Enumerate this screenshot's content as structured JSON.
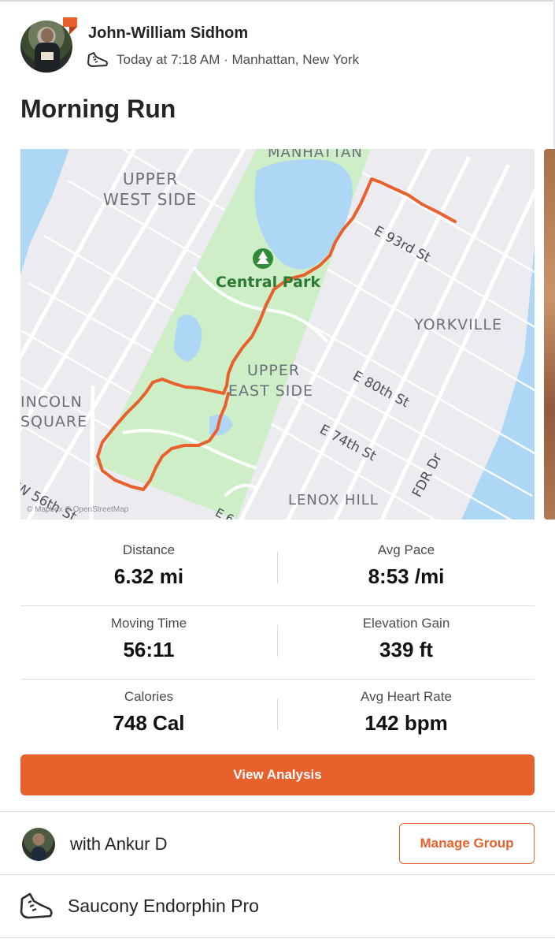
{
  "activity": {
    "athlete_name": "John-William Sidhom",
    "meta": "Today at 7:18 AM · Manhattan, New York",
    "title": "Morning Run",
    "sport_icon": "running-shoe-icon"
  },
  "map": {
    "labels": {
      "manhattan": "MANHATTAN",
      "upper_west_side_1": "UPPER",
      "upper_west_side_2": "WEST SIDE",
      "central_park": "Central Park",
      "e93": "E 93rd St",
      "yorkville": "YORKVILLE",
      "upper_east_side_1": "UPPER",
      "upper_east_side_2": "EAST SIDE",
      "e80": "E 80th St",
      "lincoln_1": "INCOLN",
      "lincoln_2": "SQUARE",
      "e74": "E 74th St",
      "w56": "W 56th St",
      "lenox_hill": "LENOX HILL",
      "fdr": "FDR Dr",
      "e6": "E 6",
      "attribution": "© Mapbox © OpenStreetMap"
    },
    "route_color": "#e8602c",
    "park_color": "#cdeec6",
    "water_color": "#aed6f5"
  },
  "stats": [
    {
      "left": {
        "label": "Distance",
        "value": "6.32 mi"
      },
      "right": {
        "label": "Avg Pace",
        "value": "8:53 /mi"
      }
    },
    {
      "left": {
        "label": "Moving Time",
        "value": "56:11"
      },
      "right": {
        "label": "Elevation Gain",
        "value": "339 ft"
      }
    },
    {
      "left": {
        "label": "Calories",
        "value": "748 Cal"
      },
      "right": {
        "label": "Avg Heart Rate",
        "value": "142 bpm"
      }
    }
  ],
  "actions": {
    "view_analysis": "View Analysis",
    "manage_group": "Manage Group"
  },
  "group": {
    "text": "with Ankur D"
  },
  "gear": {
    "text": "Saucony Endorphin Pro",
    "icon": "running-shoe-icon"
  },
  "colors": {
    "accent": "#e8602c"
  }
}
